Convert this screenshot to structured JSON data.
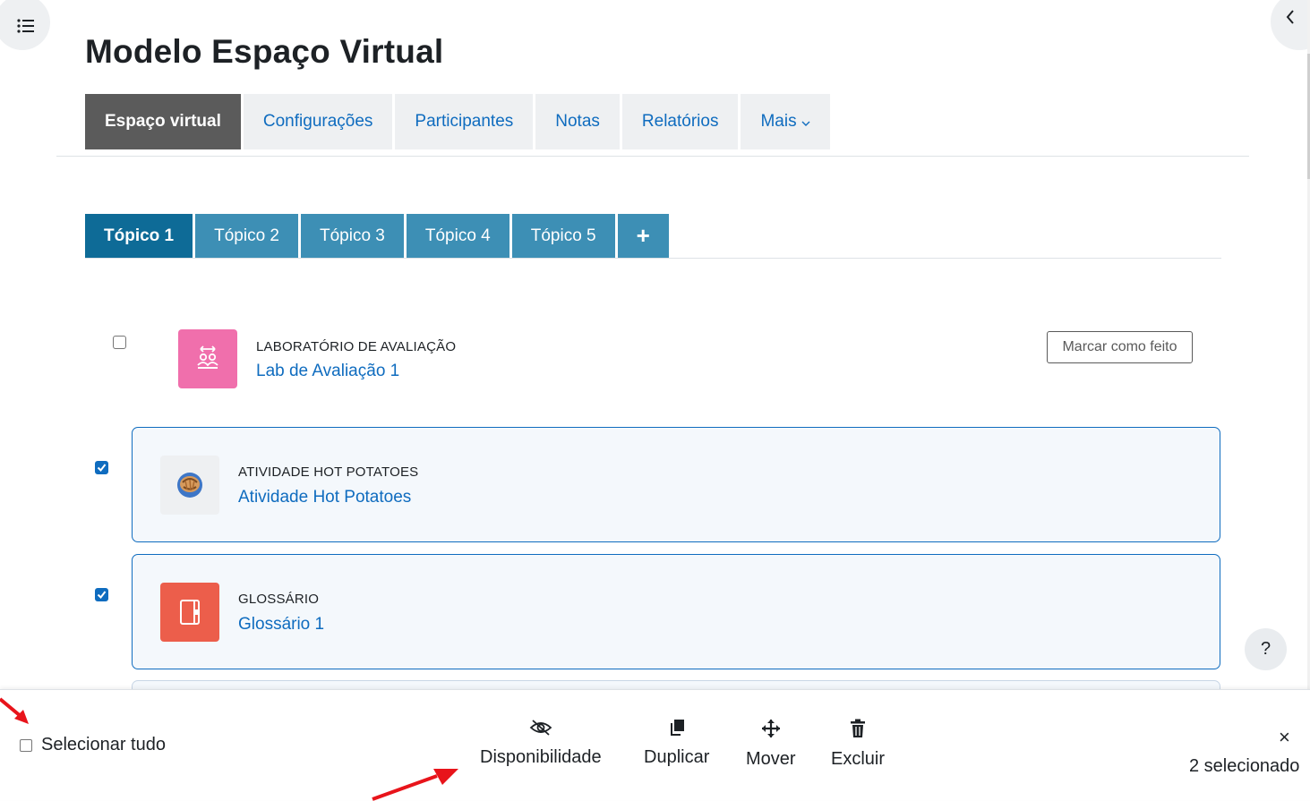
{
  "page": {
    "title": "Modelo Espaço Virtual"
  },
  "course_nav": {
    "tabs": [
      {
        "label": "Espaço virtual",
        "active": true
      },
      {
        "label": "Configurações"
      },
      {
        "label": "Participantes"
      },
      {
        "label": "Notas"
      },
      {
        "label": "Relatórios"
      },
      {
        "label": "Mais"
      }
    ]
  },
  "topic_tabs": {
    "tabs": [
      {
        "label": "Tópico 1",
        "active": true
      },
      {
        "label": "Tópico 2"
      },
      {
        "label": "Tópico 3"
      },
      {
        "label": "Tópico 4"
      },
      {
        "label": "Tópico 5"
      }
    ],
    "add_label": "+"
  },
  "activities": [
    {
      "type": "Laboratório de avaliação",
      "name": "Lab de Avaliação 1",
      "checked": false,
      "icon": "workshop-icon",
      "icon_color": "#f06fac"
    },
    {
      "type": "Atividade Hot Potatoes",
      "name": "Atividade Hot Potatoes",
      "checked": true,
      "icon": "hot-potatoes-icon",
      "icon_color": "#eef0f2"
    },
    {
      "type": "Glossário",
      "name": "Glossário 1",
      "checked": true,
      "icon": "glossary-icon",
      "icon_color": "#ec5e4b"
    }
  ],
  "completion": {
    "mark_done_label": "Marcar como feito"
  },
  "help": {
    "label": "?"
  },
  "bulk_footer": {
    "select_all_label": "Selecionar tudo",
    "actions": [
      {
        "label": "Disponibilidade",
        "icon": "eye-slash-icon"
      },
      {
        "label": "Duplicar",
        "icon": "copy-icon"
      },
      {
        "label": "Mover",
        "icon": "move-icon"
      },
      {
        "label": "Excluir",
        "icon": "trash-icon"
      }
    ],
    "close_label": "×",
    "selected_count": "2 selecionado"
  },
  "colors": {
    "link": "#0f6cbf",
    "topic_tab": "#3d8fb5",
    "topic_tab_active": "#0e6b97",
    "annotation_arrow": "#e8141b"
  }
}
